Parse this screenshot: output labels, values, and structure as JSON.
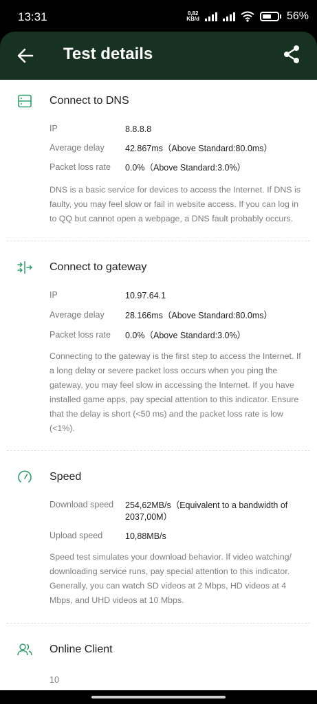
{
  "status_bar": {
    "time": "13:31",
    "net_speed_value": "0,82",
    "net_speed_unit": "KB/d",
    "battery": "56%"
  },
  "app_bar": {
    "title": "Test details",
    "back_icon": "arrow-left-icon",
    "share_icon": "share-icon"
  },
  "sections": {
    "dns": {
      "title": "Connect to DNS",
      "icon": "dns-server-icon",
      "ip_label": "IP",
      "ip_value": "8.8.8.8",
      "delay_label": "Average delay",
      "delay_value": "42.867ms（Above Standard:80.0ms）",
      "loss_label": "Packet loss rate",
      "loss_value": "0.0%（Above Standard:3.0%）",
      "description": "DNS is a basic service for devices to access the Internet. If DNS is faulty, you may feel slow or fail in website access. If you can log in to QQ but cannot open a webpage, a DNS fault probably occurs."
    },
    "gateway": {
      "title": "Connect to gateway",
      "icon": "gateway-icon",
      "ip_label": "IP",
      "ip_value": "10.97.64.1",
      "delay_label": "Average delay",
      "delay_value": "28.166ms（Above Standard:80.0ms）",
      "loss_label": "Packet loss rate",
      "loss_value": "0.0%（Above Standard:3.0%）",
      "description": "Connecting to the gateway is the first step to access the Internet. If a long delay or severe packet loss occurs when you ping the gateway, you may feel slow in accessing the Internet. If you have installed game apps, pay special attention to this indicator. Ensure that the delay is short (<50 ms) and the packet loss rate is low (<1%)."
    },
    "speed": {
      "title": "Speed",
      "icon": "speedometer-icon",
      "download_label": "Download speed",
      "download_value": "254,62MB/s（Equivalent to a bandwidth of 2037,00M）",
      "upload_label": "Upload speed",
      "upload_value": "10,88MB/s",
      "description": "Speed test simulates your download behavior. If video watching/ downloading service runs, pay special attention to this indicator. Generally, you can watch SD videos at 2 Mbps, HD videos at 4 Mbps, and UHD videos at 10 Mbps."
    },
    "clients": {
      "title": "Online Client",
      "icon": "users-icon",
      "count": "10"
    }
  },
  "colors": {
    "app_bar": "#173221",
    "accent_green": "#2e9e6b"
  }
}
